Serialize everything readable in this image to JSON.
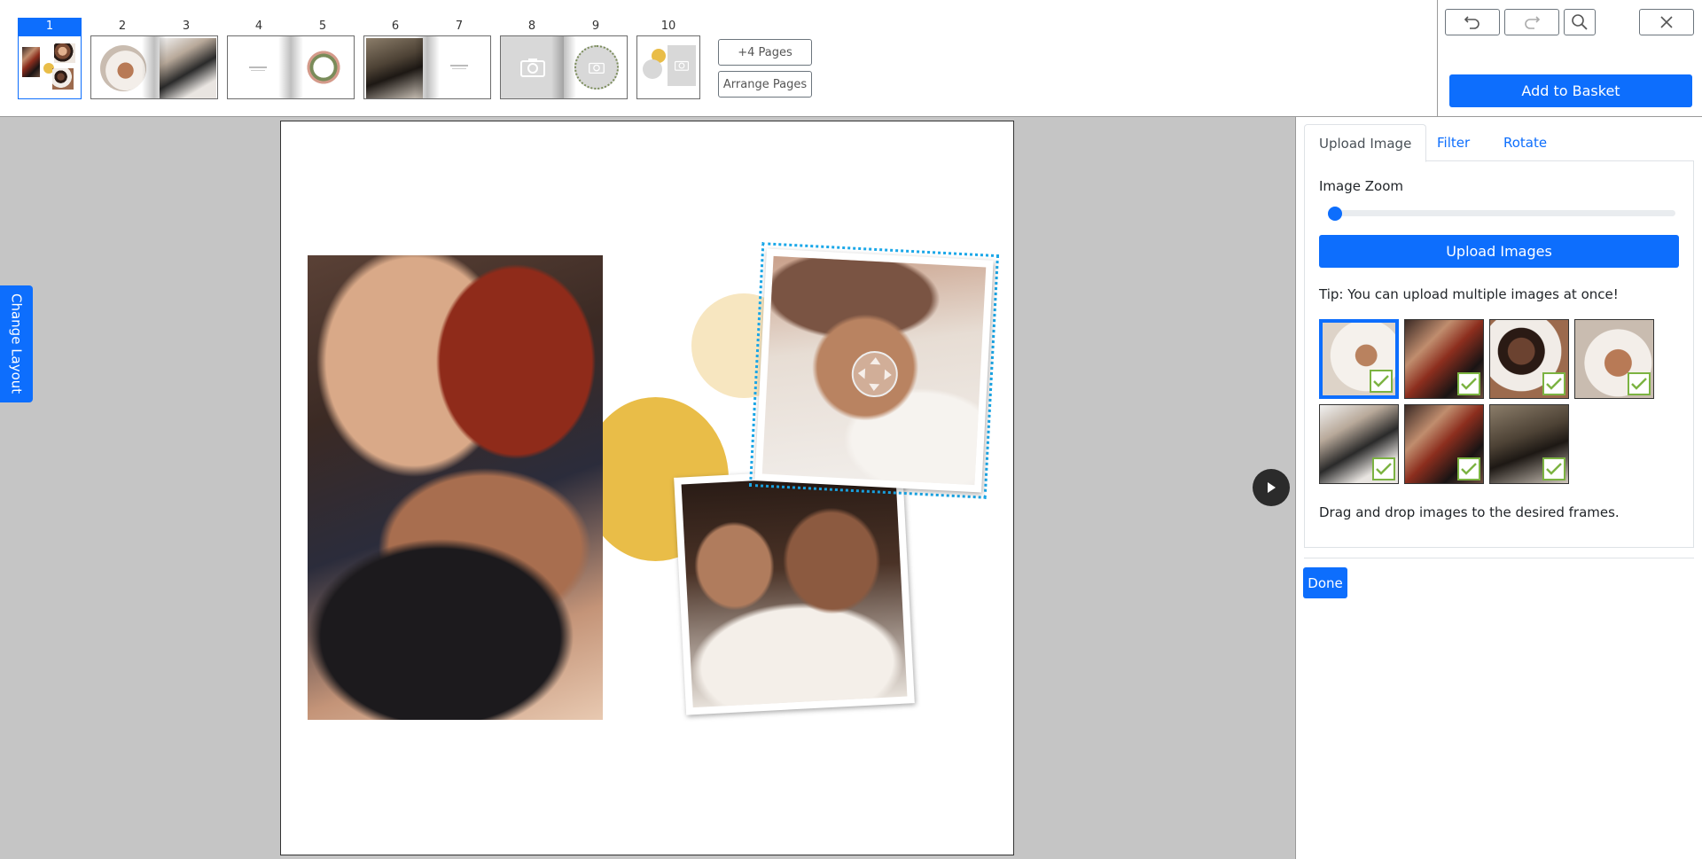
{
  "pages": {
    "groups": [
      {
        "numbers": [
          "1"
        ]
      },
      {
        "numbers": [
          "2",
          "3"
        ]
      },
      {
        "numbers": [
          "4",
          "5"
        ]
      },
      {
        "numbers": [
          "6",
          "7"
        ]
      },
      {
        "numbers": [
          "8",
          "9"
        ]
      },
      {
        "numbers": [
          "10"
        ]
      }
    ],
    "active_page": "1"
  },
  "toolbar": {
    "more_pages_label": "+4 Pages",
    "arrange_pages_label": "Arrange Pages",
    "add_to_basket_label": "Add to Basket"
  },
  "icons": {
    "undo": "undo-icon",
    "redo": "redo-icon",
    "zoom": "magnifier-icon",
    "close": "close-icon",
    "next": "play-arrow-icon",
    "camera": "camera-icon",
    "check": "checkmark-icon"
  },
  "workspace": {
    "change_layout_label": "Change Layout"
  },
  "panel": {
    "tabs": [
      {
        "label": "Upload Image",
        "active": true
      },
      {
        "label": "Filter",
        "active": false
      },
      {
        "label": "Rotate",
        "active": false
      }
    ],
    "image_zoom_label": "Image Zoom",
    "image_zoom_value": 0,
    "upload_button_label": "Upload Images",
    "tip_text": "Tip: You can upload multiple images at once!",
    "drag_text": "Drag and drop images to the desired frames.",
    "done_label": "Done",
    "images": [
      {
        "subject": "baby-hand",
        "selected": true,
        "used": true
      },
      {
        "subject": "family-kiss",
        "selected": false,
        "used": true
      },
      {
        "subject": "mom-baby",
        "selected": false,
        "used": true
      },
      {
        "subject": "baby-hands",
        "selected": false,
        "used": true
      },
      {
        "subject": "dad-kid",
        "selected": false,
        "used": true
      },
      {
        "subject": "family-kiss-2",
        "selected": false,
        "used": true
      },
      {
        "subject": "wedding",
        "selected": false,
        "used": true
      }
    ]
  },
  "colors": {
    "accent": "#0d6efd",
    "circle_yellow": "#e9bd48",
    "circle_pale": "#f7e6c0",
    "check_green": "#7cb342",
    "selection_dots": "#1aa7e8"
  }
}
